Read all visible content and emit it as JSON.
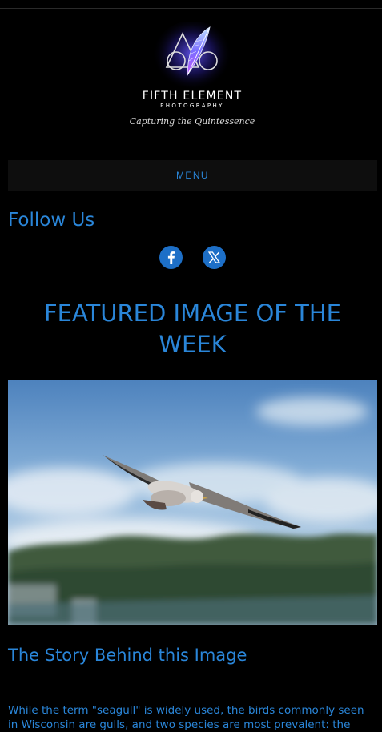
{
  "header": {
    "logo_name": "FIFTH ELEMENT",
    "logo_sub": "PHOTOGRAPHY",
    "logo_tagline": "Capturing the Quintessence"
  },
  "nav": {
    "menu_label": "MENU"
  },
  "follow": {
    "title": "Follow Us",
    "facebook_icon": "facebook-icon",
    "x_icon": "x-twitter-icon"
  },
  "featured": {
    "title": "FEATURED IMAGE OF THE WEEK",
    "image_subject": "seagull in flight"
  },
  "story": {
    "title": "The Story Behind this Image",
    "text": "While the term \"seagull\" is widely used, the birds commonly seen in Wisconsin are gulls, and two species are most prevalent: the"
  },
  "colors": {
    "accent": "#2a86d9",
    "background": "#000000",
    "menu_bar": "#0e0e0e",
    "social_circle": "#1d6fc7"
  }
}
